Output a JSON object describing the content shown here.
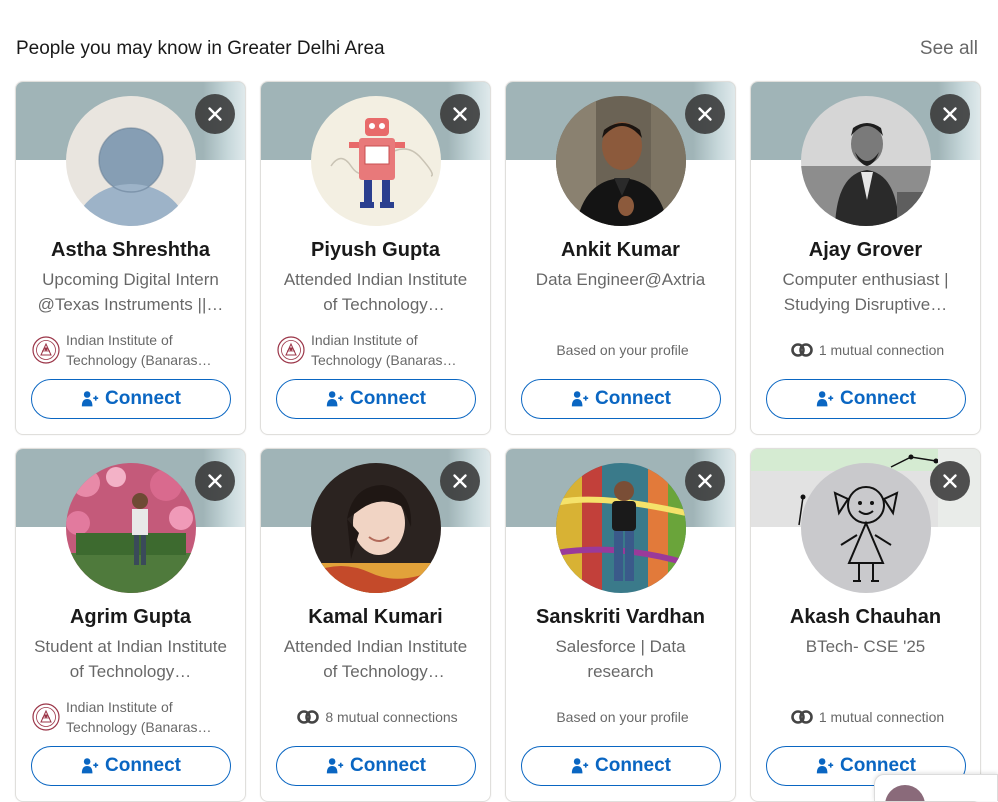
{
  "section": {
    "title": "People you may know in Greater Delhi Area",
    "see_all": "See all"
  },
  "connect_label": "Connect",
  "colors": {
    "brand_blue": "#0a66c2",
    "banner": "#a0b4b7"
  },
  "cards": [
    {
      "name": "Astha Shreshtha",
      "headline": "Upcoming Digital Intern @Texas Instruments ||…",
      "insight_type": "school",
      "insight": "Indian Institute of Technology (Banaras…",
      "avatar": "default-silhouette"
    },
    {
      "name": "Piyush Gupta",
      "headline": "Attended Indian Institute of Technology (Banaras…",
      "insight_type": "school",
      "insight": "Indian Institute of Technology (Banaras…",
      "avatar": "robot-illustration"
    },
    {
      "name": "Ankit Kumar",
      "headline": "Data Engineer@Axtria",
      "insight_type": "profile",
      "insight": "Based on your profile",
      "avatar": "photo"
    },
    {
      "name": "Ajay Grover",
      "headline": "Computer enthusiast | Studying Disruptive…",
      "insight_type": "mutual",
      "insight": "1 mutual connection",
      "avatar": "photo-bw"
    },
    {
      "name": "Agrim Gupta",
      "headline": "Student at Indian Institute of Technology…",
      "insight_type": "school",
      "insight": "Indian Institute of Technology (Banaras…",
      "avatar": "photo-flowers"
    },
    {
      "name": "Kamal Kumari",
      "headline": "Attended Indian Institute of Technology (Banaras…",
      "insight_type": "mutual",
      "insight": "8 mutual connections",
      "avatar": "photo"
    },
    {
      "name": "Sanskriti Vardhan",
      "headline": "Salesforce | Data research",
      "insight_type": "profile",
      "insight": "Based on your profile",
      "avatar": "photo-graffiti"
    },
    {
      "name": "Akash Chauhan",
      "headline": "BTech- CSE '25",
      "insight_type": "mutual",
      "insight": "1 mutual connection",
      "avatar": "doodle-girl"
    }
  ]
}
